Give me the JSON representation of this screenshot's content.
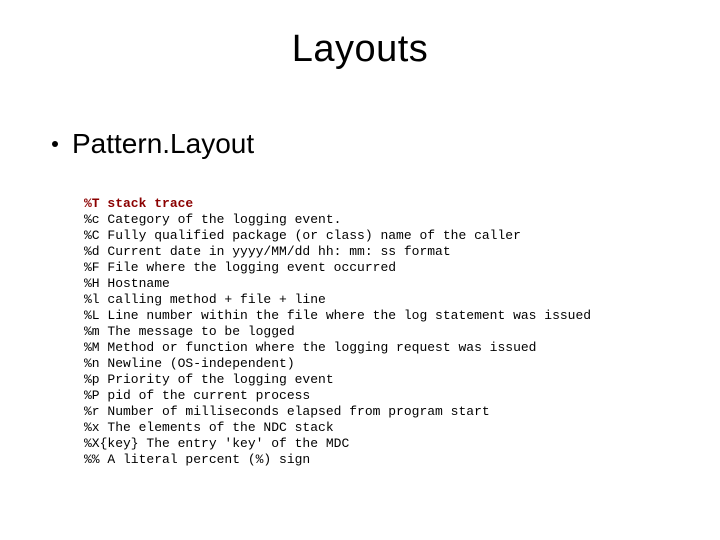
{
  "title": "Layouts",
  "bullet": "Pattern.Layout",
  "lines": [
    {
      "code": "%T",
      "desc": "stack trace",
      "first": true
    },
    {
      "code": "%c",
      "desc": "Category of the logging event."
    },
    {
      "code": "%C",
      "desc": "Fully qualified package (or class) name of the caller"
    },
    {
      "code": "%d",
      "desc": "Current date in yyyy/MM/dd hh: mm: ss format"
    },
    {
      "code": "%F",
      "desc": "File where the logging event occurred"
    },
    {
      "code": "%H",
      "desc": "Hostname"
    },
    {
      "code": "%l",
      "desc": "calling method + file + line"
    },
    {
      "code": "%L",
      "desc": "Line number within the file where the log statement was issued"
    },
    {
      "code": "%m",
      "desc": "The message to be logged"
    },
    {
      "code": "%M",
      "desc": "Method or function where the logging request was issued"
    },
    {
      "code": "%n",
      "desc": "Newline (OS-independent)"
    },
    {
      "code": "%p",
      "desc": "Priority of the logging event"
    },
    {
      "code": "%P",
      "desc": "pid of the current process"
    },
    {
      "code": "%r",
      "desc": "Number of milliseconds elapsed from program start"
    },
    {
      "code": "%x",
      "desc": "The elements of the NDC stack"
    },
    {
      "code": "%X{key}",
      "desc": "The entry 'key' of the MDC"
    },
    {
      "code": "%%",
      "desc": "A literal percent (%) sign"
    }
  ]
}
